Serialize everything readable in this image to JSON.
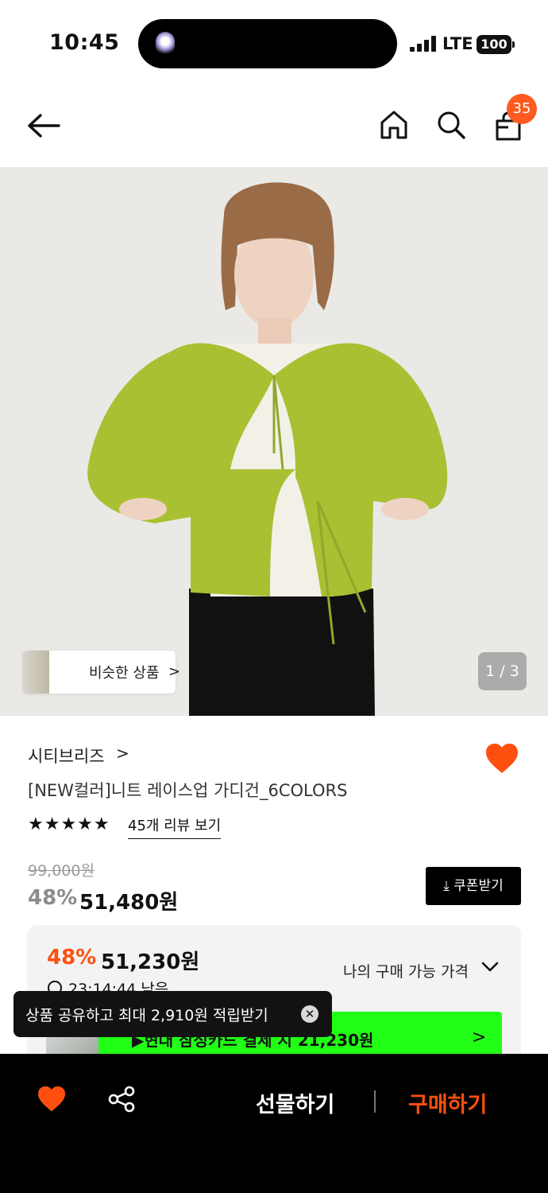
{
  "status_bar": {
    "time": "10:45",
    "network": "LTE",
    "battery": "100"
  },
  "nav": {
    "back_icon": "arrow-left-icon",
    "home_icon": "home-icon",
    "search_icon": "search-icon",
    "cart_icon": "shopping-bag-icon",
    "cart_count": "35"
  },
  "hero": {
    "similar_label": "비슷한 상품",
    "similar_chevron": ">",
    "pager": "1 / 3"
  },
  "product": {
    "brand": "시티브리즈",
    "brand_chevron": ">",
    "title": "[NEW컬러]니트 레이스업 가디건_6COLORS",
    "rating_stars": 5,
    "stars": "★★★★★",
    "review_link": "45개 리뷰 보기",
    "original_price": "99,000원",
    "discount_percent": "48%",
    "price": "51,480원",
    "coupon_button": "⤓ 쿠폰받기"
  },
  "member_price": {
    "discount_percent": "48%",
    "price": "51,230원",
    "label": "나의 구매 가능 가격",
    "timer": "23:14:44 남음",
    "promo": "▶현대 삼성카드 결제 시 21,230원",
    "promo_chevron": ">"
  },
  "toast": {
    "message": "상품 공유하고 최대 2,910원 적립받기",
    "close": "✕"
  },
  "bottom_bar": {
    "heart_icon": "heart-icon",
    "share_icon": "share-icon",
    "gift_label": "선물하기",
    "buy_label": "구매하기"
  },
  "colors": {
    "accent": "#ff4f0f",
    "promo_green": "#22ff16",
    "badge": "#ff5a1f",
    "bottom_bar": "#000000"
  }
}
